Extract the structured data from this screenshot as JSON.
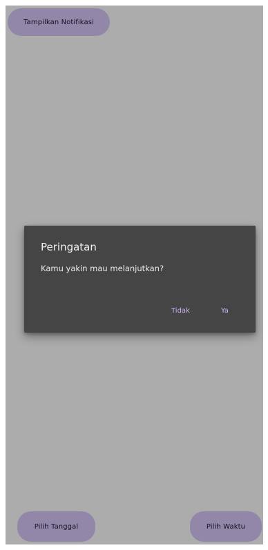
{
  "buttons": {
    "show_notification": "Tampilkan Notifikasi",
    "pick_date": "Pilih Tanggal",
    "pick_time": "Pilih Waktu"
  },
  "dialog": {
    "title": "Peringatan",
    "message": "Kamu yakin mau melanjutkan?",
    "negative_label": "Tidak",
    "positive_label": "Ya"
  },
  "colors": {
    "button_fill": "#d1c2f2",
    "button_fill_dimmed": "#9385b3",
    "background_dimmed": "#acacac",
    "dialog_background": "#454545",
    "dialog_action_text": "#c9b4ee"
  }
}
